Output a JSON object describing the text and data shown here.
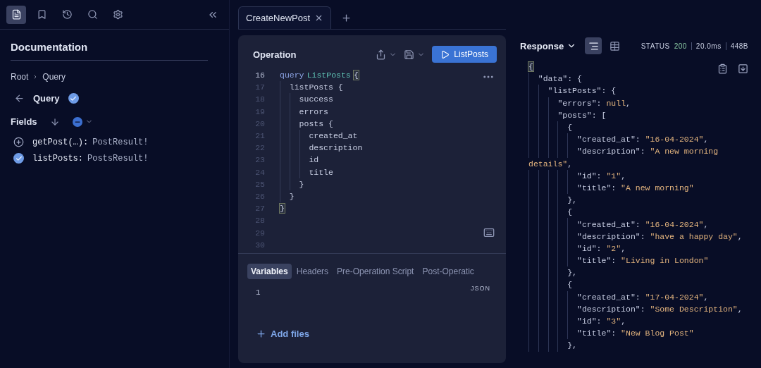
{
  "sidebar": {
    "toolbar": [
      {
        "kind": "docs",
        "selected": true
      },
      {
        "kind": "bookmark",
        "selected": false
      },
      {
        "kind": "history",
        "selected": false
      },
      {
        "kind": "search",
        "selected": false
      },
      {
        "kind": "settings",
        "selected": false
      }
    ],
    "title": "Documentation",
    "breadcrumb": [
      "Root",
      "Query"
    ],
    "type_name": "Query",
    "fields_label": "Fields",
    "fields": [
      {
        "name": "getPost(…):",
        "type": "PostResult!",
        "selected": false
      },
      {
        "name": "listPosts:",
        "type": "PostsResult!",
        "selected": true
      }
    ]
  },
  "tabs": [
    {
      "label": "CreateNewPost",
      "selected": true
    }
  ],
  "operation": {
    "title": "Operation",
    "run_button": "ListPosts",
    "lines": [
      {
        "number": "16",
        "parts": [
          {
            "kind": "keyword",
            "text": "query"
          },
          {
            "kind": "name",
            "text": "ListPosts"
          },
          {
            "kind": "match",
            "text": "{"
          }
        ]
      },
      {
        "number": "17",
        "parts": [
          {
            "kind": "plain",
            "text": "  listPosts {"
          }
        ]
      },
      {
        "number": "18",
        "parts": [
          {
            "kind": "plain",
            "text": "    success"
          }
        ]
      },
      {
        "number": "19",
        "parts": [
          {
            "kind": "plain",
            "text": "    errors"
          }
        ]
      },
      {
        "number": "20",
        "parts": [
          {
            "kind": "plain",
            "text": "    posts {"
          }
        ]
      },
      {
        "number": "21",
        "parts": [
          {
            "kind": "plain",
            "text": "      created_at"
          }
        ]
      },
      {
        "number": "22",
        "parts": [
          {
            "kind": "plain",
            "text": "      description"
          }
        ]
      },
      {
        "number": "23",
        "parts": [
          {
            "kind": "plain",
            "text": "      id"
          }
        ]
      },
      {
        "number": "24",
        "parts": [
          {
            "kind": "plain",
            "text": "      title"
          }
        ]
      },
      {
        "number": "25",
        "parts": [
          {
            "kind": "plain",
            "text": "    }"
          }
        ]
      },
      {
        "number": "26",
        "parts": [
          {
            "kind": "plain",
            "text": "  }"
          }
        ]
      },
      {
        "number": "27",
        "parts": [
          {
            "kind": "match",
            "text": "}"
          }
        ]
      },
      {
        "number": "28"
      },
      {
        "number": "29"
      },
      {
        "number": "30"
      }
    ],
    "bottom_tabs": [
      {
        "label": "Variables",
        "selected": true
      },
      {
        "label": "Headers",
        "selected": false
      },
      {
        "label": "Pre-Operation Script",
        "selected": false
      },
      {
        "label": "Post-Operatic",
        "selected": false
      }
    ],
    "variables_lines": [
      "1"
    ],
    "format_label": "JSON",
    "add_files": "Add files"
  },
  "response": {
    "title": "Response",
    "views": [
      {
        "kind": "text",
        "selected": true
      },
      {
        "kind": "table",
        "selected": false
      }
    ],
    "status_label": "STATUS",
    "status_code": "200",
    "time": "20.0ms",
    "size": "448B",
    "lines": [
      [
        {
          "kind": "match",
          "text": "{"
        }
      ],
      [
        {
          "kind": "key",
          "text": "  \"data\""
        },
        {
          "kind": "plain",
          "text": ": {"
        }
      ],
      [
        {
          "kind": "key",
          "text": "    \"listPosts\""
        },
        {
          "kind": "plain",
          "text": ": {"
        }
      ],
      [
        {
          "kind": "key",
          "text": "      \"errors\""
        },
        {
          "kind": "plain",
          "text": ": "
        },
        {
          "kind": "string",
          "text": "null"
        },
        {
          "kind": "plain",
          "text": ","
        }
      ],
      [
        {
          "kind": "key",
          "text": "      \"posts\""
        },
        {
          "kind": "plain",
          "text": ": ["
        }
      ],
      [
        {
          "kind": "plain",
          "text": "        {"
        }
      ],
      [
        {
          "kind": "key",
          "text": "          \"created_at\""
        },
        {
          "kind": "plain",
          "text": ": "
        },
        {
          "kind": "string",
          "text": "\"16-04-2024\""
        },
        {
          "kind": "plain",
          "text": ","
        }
      ],
      [
        {
          "kind": "key",
          "text": "          \"description\""
        },
        {
          "kind": "plain",
          "text": ": "
        },
        {
          "kind": "string",
          "text": "\"A new morning"
        }
      ],
      [
        {
          "kind": "string",
          "text": "details\""
        },
        {
          "kind": "plain",
          "text": ","
        }
      ],
      [
        {
          "kind": "key",
          "text": "          \"id\""
        },
        {
          "kind": "plain",
          "text": ": "
        },
        {
          "kind": "string",
          "text": "\"1\""
        },
        {
          "kind": "plain",
          "text": ","
        }
      ],
      [
        {
          "kind": "key",
          "text": "          \"title\""
        },
        {
          "kind": "plain",
          "text": ": "
        },
        {
          "kind": "string",
          "text": "\"A new morning\""
        }
      ],
      [
        {
          "kind": "plain",
          "text": "        },"
        }
      ],
      [
        {
          "kind": "plain",
          "text": "        {"
        }
      ],
      [
        {
          "kind": "key",
          "text": "          \"created_at\""
        },
        {
          "kind": "plain",
          "text": ": "
        },
        {
          "kind": "string",
          "text": "\"16-04-2024\""
        },
        {
          "kind": "plain",
          "text": ","
        }
      ],
      [
        {
          "kind": "key",
          "text": "          \"description\""
        },
        {
          "kind": "plain",
          "text": ": "
        },
        {
          "kind": "string",
          "text": "\"have a happy day\""
        },
        {
          "kind": "plain",
          "text": ","
        }
      ],
      [
        {
          "kind": "key",
          "text": "          \"id\""
        },
        {
          "kind": "plain",
          "text": ": "
        },
        {
          "kind": "string",
          "text": "\"2\""
        },
        {
          "kind": "plain",
          "text": ","
        }
      ],
      [
        {
          "kind": "key",
          "text": "          \"title\""
        },
        {
          "kind": "plain",
          "text": ": "
        },
        {
          "kind": "string",
          "text": "\"Living in London\""
        }
      ],
      [
        {
          "kind": "plain",
          "text": "        },"
        }
      ],
      [
        {
          "kind": "plain",
          "text": "        {"
        }
      ],
      [
        {
          "kind": "key",
          "text": "          \"created_at\""
        },
        {
          "kind": "plain",
          "text": ": "
        },
        {
          "kind": "string",
          "text": "\"17-04-2024\""
        },
        {
          "kind": "plain",
          "text": ","
        }
      ],
      [
        {
          "kind": "key",
          "text": "          \"description\""
        },
        {
          "kind": "plain",
          "text": ": "
        },
        {
          "kind": "string",
          "text": "\"Some Description\""
        },
        {
          "kind": "plain",
          "text": ","
        }
      ],
      [
        {
          "kind": "key",
          "text": "          \"id\""
        },
        {
          "kind": "plain",
          "text": ": "
        },
        {
          "kind": "string",
          "text": "\"3\""
        },
        {
          "kind": "plain",
          "text": ","
        }
      ],
      [
        {
          "kind": "key",
          "text": "          \"title\""
        },
        {
          "kind": "plain",
          "text": ": "
        },
        {
          "kind": "string",
          "text": "\"New Blog Post\""
        }
      ],
      [
        {
          "kind": "plain",
          "text": "        },"
        }
      ]
    ]
  }
}
